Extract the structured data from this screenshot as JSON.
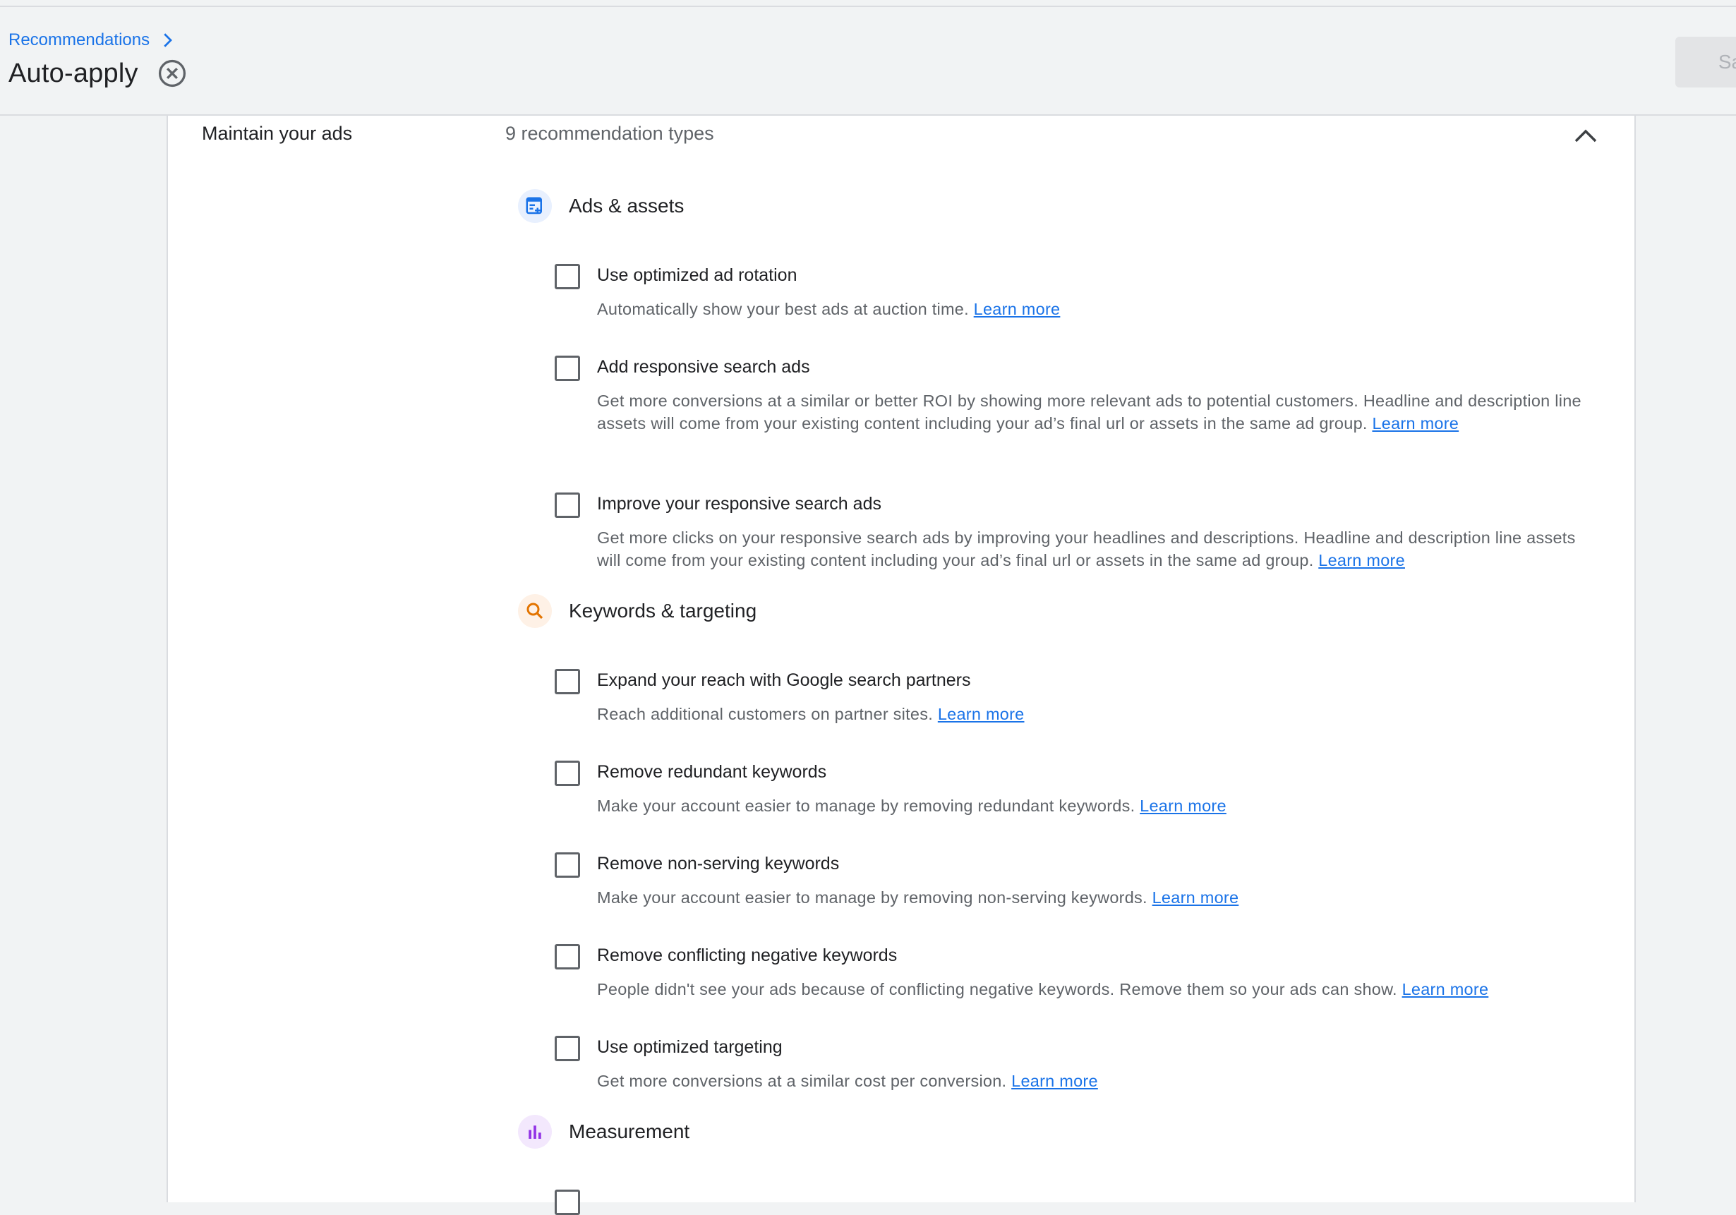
{
  "breadcrumb": {
    "parent": "Recommendations"
  },
  "header": {
    "title": "Auto-apply",
    "save_label": "Sav"
  },
  "section": {
    "name": "Maintain your ads",
    "count": "9 recommendation types"
  },
  "colors": {
    "link": "#1a73e8",
    "ads_icon_bg": "#e8f0fe",
    "keywords_icon_bg": "#fef1e6",
    "measurement_icon_bg": "#f3e8fd"
  },
  "groups": [
    {
      "label": "Ads & assets",
      "icon": "ads-assets-icon"
    },
    {
      "label": "Keywords & targeting",
      "icon": "search-icon"
    },
    {
      "label": "Measurement",
      "icon": "bar-chart-icon"
    }
  ],
  "items": [
    {
      "title": "Use optimized ad rotation",
      "desc": "Automatically show your best ads at auction time.",
      "link": "Learn more"
    },
    {
      "title": "Add responsive search ads",
      "desc": "Get more conversions at a similar or better ROI by showing more relevant ads to potential customers. Headline and description line assets will come from your existing content including your ad’s final url or assets in the same ad group.",
      "link": "Learn more"
    },
    {
      "title": "Improve your responsive search ads",
      "desc": "Get more clicks on your responsive search ads by improving your headlines and descriptions. Headline and description line assets will come from your existing content including your ad’s final url or assets in the same ad group.",
      "link": "Learn more"
    },
    {
      "title": "Expand your reach with Google search partners",
      "desc": "Reach additional customers on partner sites.",
      "link": "Learn more"
    },
    {
      "title": "Remove redundant keywords",
      "desc": "Make your account easier to manage by removing redundant keywords.",
      "link": "Learn more"
    },
    {
      "title": "Remove non-serving keywords",
      "desc": "Make your account easier to manage by removing non-serving keywords.",
      "link": "Learn more"
    },
    {
      "title": "Remove conflicting negative keywords",
      "desc": "People didn't see your ads because of conflicting negative keywords. Remove them so your ads can show.",
      "link": "Learn more"
    },
    {
      "title": "Use optimized targeting",
      "desc": "Get more conversions at a similar cost per conversion.",
      "link": "Learn more"
    }
  ]
}
